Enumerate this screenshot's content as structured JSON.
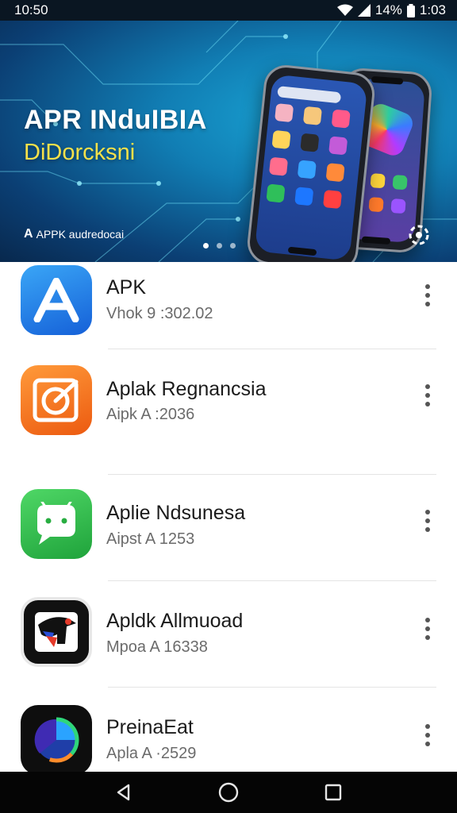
{
  "status_bar": {
    "time_left": "10:50",
    "battery": "14%",
    "time_right": "1:03",
    "icons": [
      "wifi-icon",
      "signal-icon",
      "battery-icon"
    ]
  },
  "banner": {
    "title": "APR INduIBIA",
    "subtitle": "DiDorcksni",
    "brand_text": "APPK audredocai",
    "brand_logo": "A",
    "dots": 3,
    "active_dot": 0,
    "colors": {
      "title": "#ffffff",
      "subtitle": "#f6e14a",
      "background": "#117eb4"
    }
  },
  "apps": [
    {
      "name": "APK",
      "meta": "Vhok 9 :302.02",
      "icon": "apk-store-icon",
      "colors": [
        "#2d9cf2",
        "#1663d9"
      ]
    },
    {
      "name": "Aplak Regnancsia",
      "meta": "Aipk A :2036",
      "icon": "target-icon",
      "colors": [
        "#ff8a2a",
        "#ef5a12"
      ]
    },
    {
      "name": "Aplie Ndsunesa",
      "meta": "Aipst A 1253",
      "icon": "android-chat-icon",
      "colors": [
        "#46d05a",
        "#1ea63a"
      ]
    },
    {
      "name": "Apldk Allmuoad",
      "meta": "Mpoa A 16338",
      "icon": "bird-logo-icon",
      "colors": [
        "#ffffff",
        "#1a1a1a"
      ]
    },
    {
      "name": "PreinaEat",
      "meta": "Apla A ·2529",
      "icon": "ring-gauge-icon",
      "colors": [
        "#111111",
        "#2aa3ff"
      ]
    }
  ],
  "nav": {
    "back": "back-icon",
    "home": "home-icon",
    "recents": "recents-icon"
  }
}
